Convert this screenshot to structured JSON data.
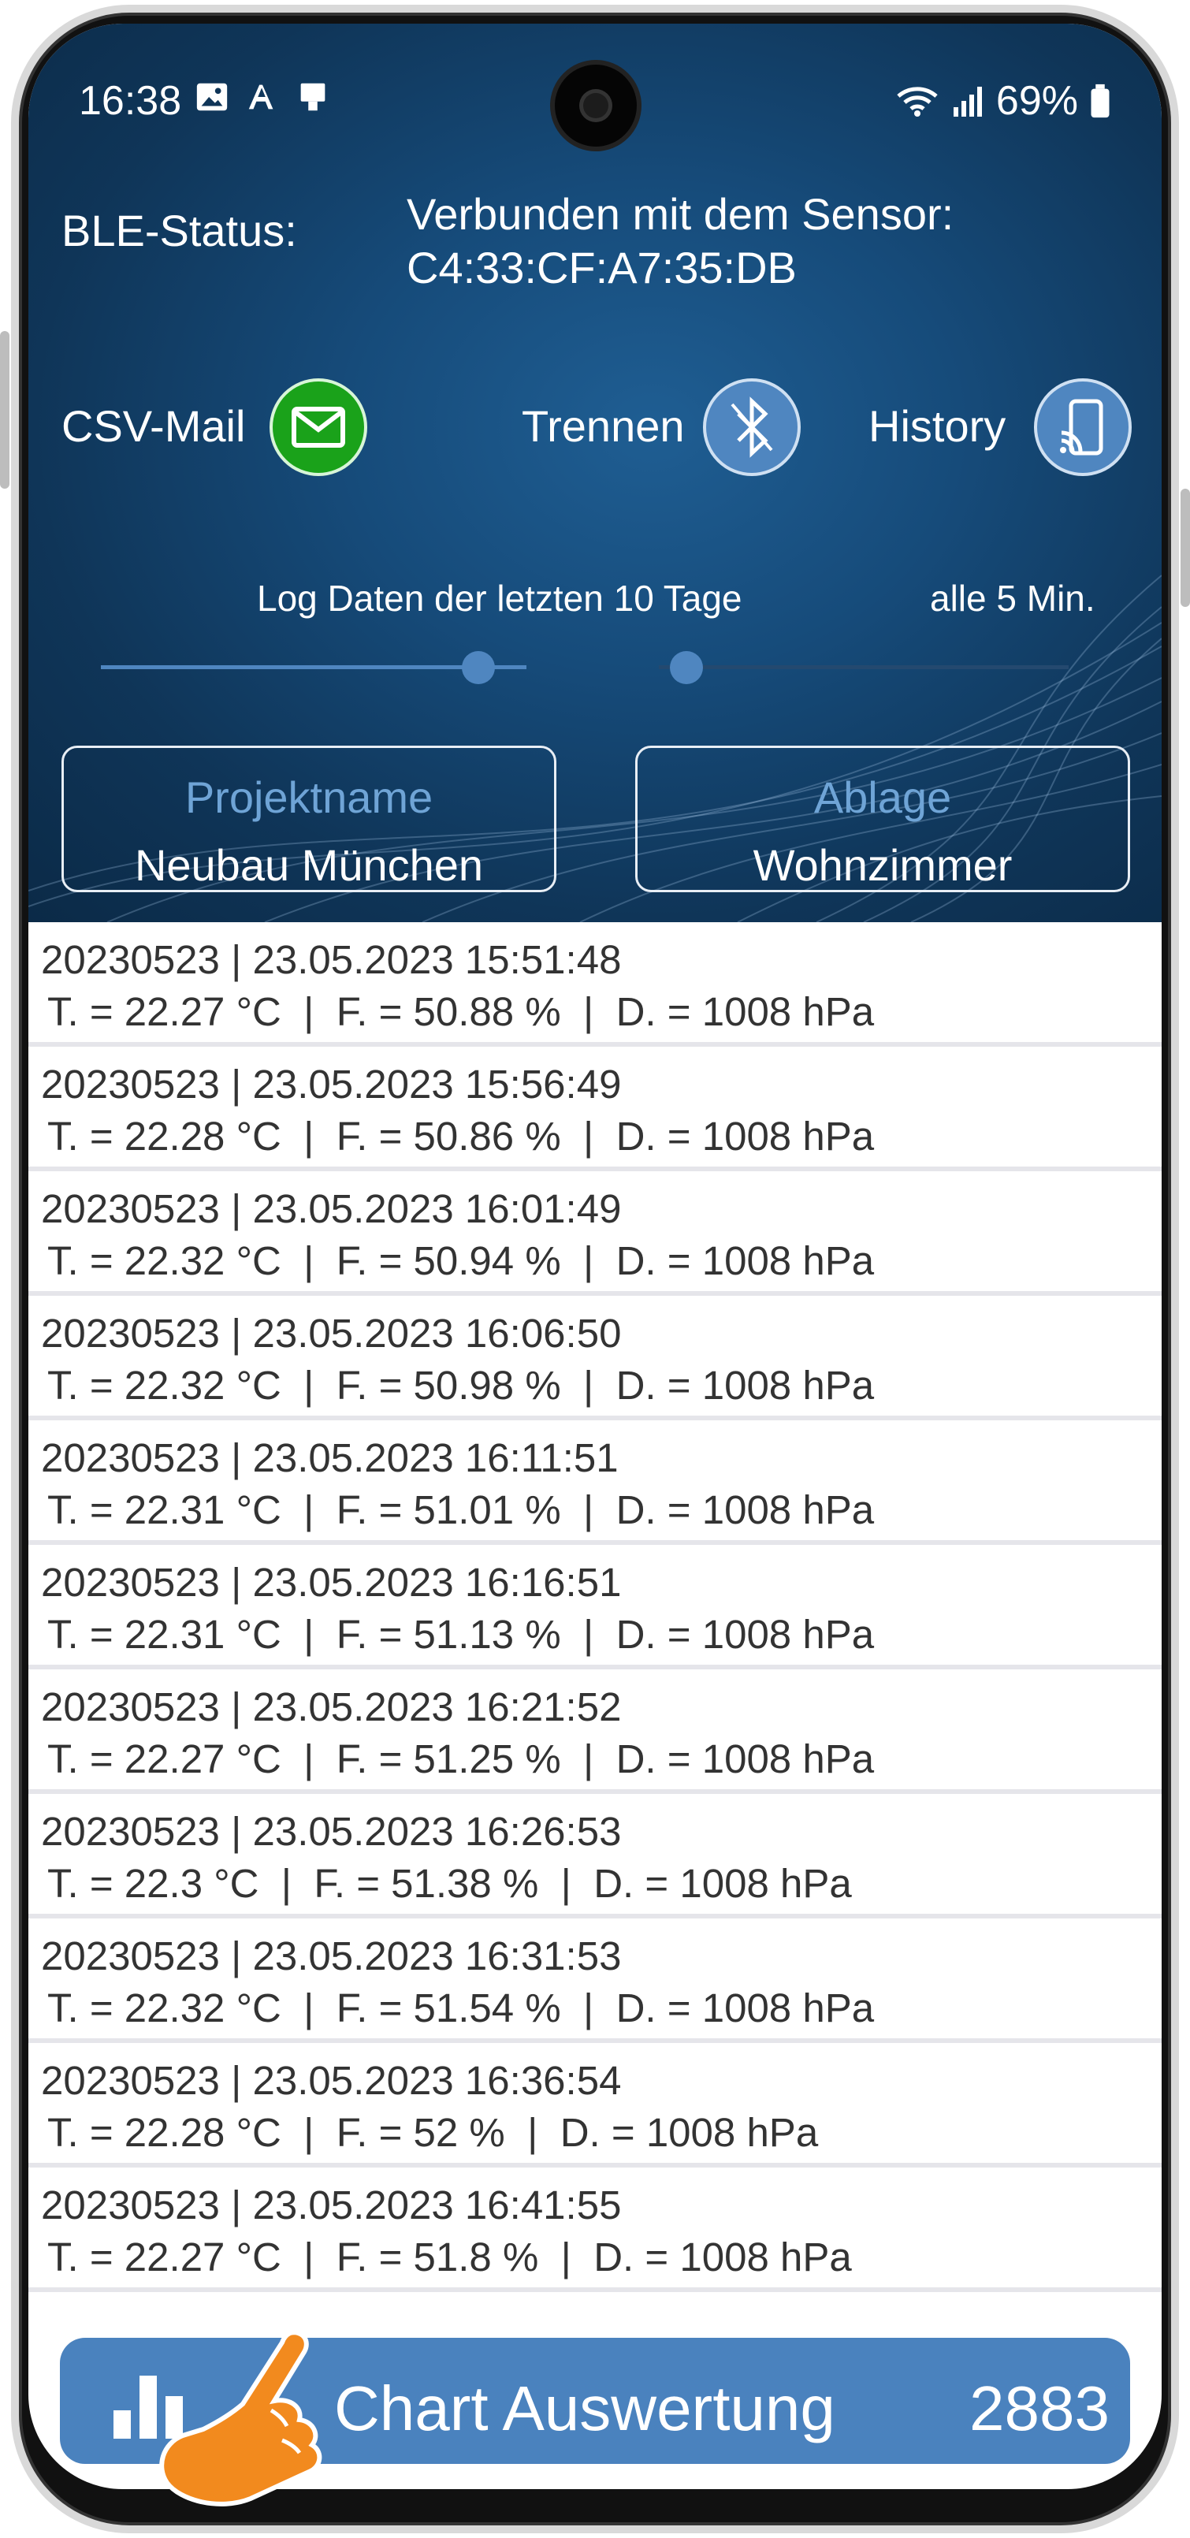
{
  "status_bar": {
    "time": "16:38",
    "battery": "69%"
  },
  "ble": {
    "label": "BLE-Status:",
    "status_line1": "Verbunden mit dem Sensor:",
    "status_line2": "C4:33:CF:A7:35:DB"
  },
  "actions": {
    "csv_mail": "CSV-Mail",
    "disconnect": "Trennen",
    "history": "History"
  },
  "log": {
    "days_label": "Log Daten der letzten 10 Tage",
    "interval_label": "alle 5 Min.",
    "days_slider_fraction": 0.92,
    "interval_slider_fraction": 0.03
  },
  "fields": {
    "project_label": "Projektname",
    "project_value": "Neubau München",
    "location_label": "Ablage",
    "location_value": "Wohnzimmer"
  },
  "records": [
    {
      "line1": "20230523 | 23.05.2023 15:51:48",
      "line2": "T. = 22.27 °C  |  F. = 50.88 %  |  D. = 1008 hPa"
    },
    {
      "line1": "20230523 | 23.05.2023 15:56:49",
      "line2": "T. = 22.28 °C  |  F. = 50.86 %  |  D. = 1008 hPa"
    },
    {
      "line1": "20230523 | 23.05.2023 16:01:49",
      "line2": "T. = 22.32 °C  |  F. = 50.94 %  |  D. = 1008 hPa"
    },
    {
      "line1": "20230523 | 23.05.2023 16:06:50",
      "line2": "T. = 22.32 °C  |  F. = 50.98 %  |  D. = 1008 hPa"
    },
    {
      "line1": "20230523 | 23.05.2023 16:11:51",
      "line2": "T. = 22.31 °C  |  F. = 51.01 %  |  D. = 1008 hPa"
    },
    {
      "line1": "20230523 | 23.05.2023 16:16:51",
      "line2": "T. = 22.31 °C  |  F. = 51.13 %  |  D. = 1008 hPa"
    },
    {
      "line1": "20230523 | 23.05.2023 16:21:52",
      "line2": "T. = 22.27 °C  |  F. = 51.25 %  |  D. = 1008 hPa"
    },
    {
      "line1": "20230523 | 23.05.2023 16:26:53",
      "line2": "T. = 22.3 °C  |  F. = 51.38 %  |  D. = 1008 hPa"
    },
    {
      "line1": "20230523 | 23.05.2023 16:31:53",
      "line2": "T. = 22.32 °C  |  F. = 51.54 %  |  D. = 1008 hPa"
    },
    {
      "line1": "20230523 | 23.05.2023 16:36:54",
      "line2": "T. = 22.28 °C  |  F. = 52 %  |  D. = 1008 hPa"
    },
    {
      "line1": "20230523 | 23.05.2023 16:41:55",
      "line2": "T. = 22.27 °C  |  F. = 51.8 %  |  D. = 1008 hPa"
    }
  ],
  "chart_button": {
    "label": "Chart Auswertung",
    "count": "2883"
  },
  "colors": {
    "accent": "#4a82be",
    "mail_green": "#1aa21a",
    "hero_dark": "#0b2a47"
  }
}
